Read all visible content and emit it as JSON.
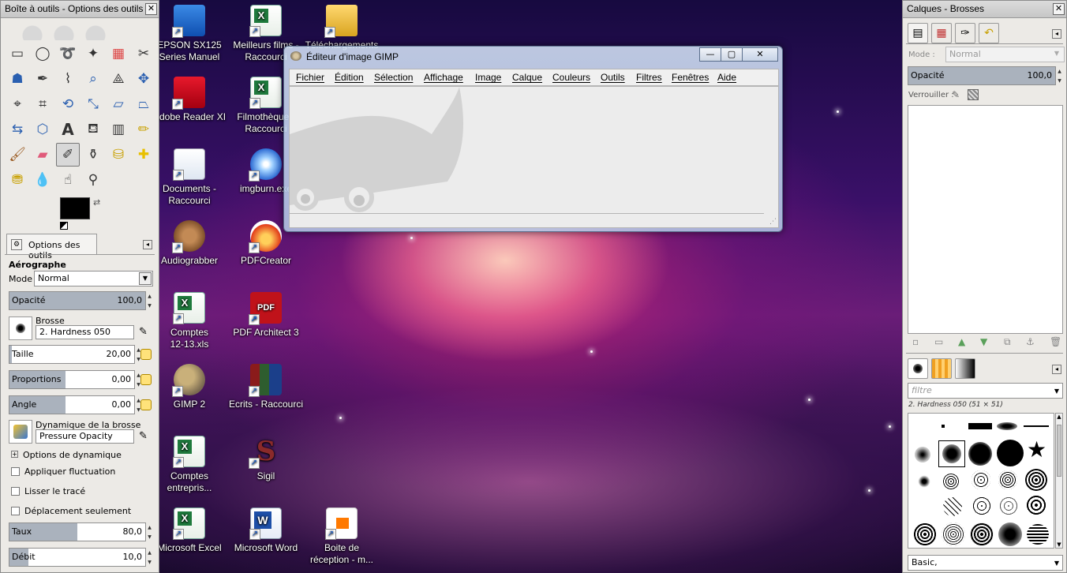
{
  "desktop": {
    "icons": [
      {
        "label": "EPSON SX125\nSeries Manuel",
        "icon": "monitor-icon"
      },
      {
        "label": "Meilleurs films -\nRaccourci",
        "icon": "excel-icon"
      },
      {
        "label": "Téléchargements",
        "icon": "folder-icon"
      },
      {
        "label": "Adobe Reader XI",
        "icon": "acrobat-icon"
      },
      {
        "label": "Filmothèque -\nRaccourci",
        "icon": "excel-icon"
      },
      {
        "label": "Documents -\nRaccourci",
        "icon": "documents-icon"
      },
      {
        "label": "imgburn.exe",
        "icon": "disc-icon"
      },
      {
        "label": "Audiograbber",
        "icon": "paw-icon"
      },
      {
        "label": "PDFCreator",
        "icon": "pdfcreator-icon"
      },
      {
        "label": "Comptes\n12-13.xls",
        "icon": "excel-icon"
      },
      {
        "label": "PDF Architect 3",
        "icon": "pdf-icon"
      },
      {
        "label": "GIMP 2",
        "icon": "gimp-icon"
      },
      {
        "label": "Ecrits - Raccourci",
        "icon": "books-icon"
      },
      {
        "label": "Comptes\nentrepris...",
        "icon": "excel-icon"
      },
      {
        "label": "Sigil",
        "icon": "sigil-icon"
      },
      {
        "label": "Microsoft Excel",
        "icon": "excel-icon"
      },
      {
        "label": "Microsoft Word",
        "icon": "word-icon"
      },
      {
        "label": "Boite de\nréception - m...",
        "icon": "mail-icon"
      }
    ]
  },
  "toolbox": {
    "title": "Boîte à outils - Options des outils",
    "tab_label": "Options des outils",
    "tool_name": "Aérographe",
    "mode_label": "Mode :",
    "mode_value": "Normal",
    "opacity_label": "Opacité",
    "opacity_value": "100,0",
    "brush_label": "Brosse",
    "brush_value": "2. Hardness 050",
    "size_label": "Taille",
    "size_value": "20,00",
    "ratio_label": "Proportions",
    "ratio_value": "0,00",
    "angle_label": "Angle",
    "angle_value": "0,00",
    "dynamics_label": "Dynamique de la brosse",
    "dynamics_value": "Pressure Opacity",
    "dynamics_options": "Options de dynamique",
    "jitter_label": "Appliquer fluctuation",
    "smooth_label": "Lisser le tracé",
    "incremental_label": "Déplacement seulement",
    "rate_label": "Taux",
    "rate_value": "80,0",
    "flow_label": "Débit",
    "flow_value": "10,0",
    "opacity_fraction": 1.0,
    "size_fraction": 0.02,
    "rate_fraction": 0.5
  },
  "gimp_window": {
    "title": "Éditeur d'image GIMP",
    "menu": [
      "Fichier",
      "Édition",
      "Sélection",
      "Affichage",
      "Image",
      "Calque",
      "Couleurs",
      "Outils",
      "Filtres",
      "Fenêtres",
      "Aide"
    ]
  },
  "layers_dock": {
    "title": "Calques - Brosses",
    "mode_label": "Mode :",
    "mode_value": "Normal",
    "opacity_label": "Opacité",
    "opacity_value": "100,0",
    "lock_label": "Verrouiller :",
    "filter_placeholder": "filtre",
    "brush_name": "2. Hardness 050 (51 × 51)",
    "brush_set": "Basic,"
  },
  "colors": {
    "fg": "#000000",
    "bg": "#ffffff",
    "slider_fill": "#aab2bd"
  }
}
